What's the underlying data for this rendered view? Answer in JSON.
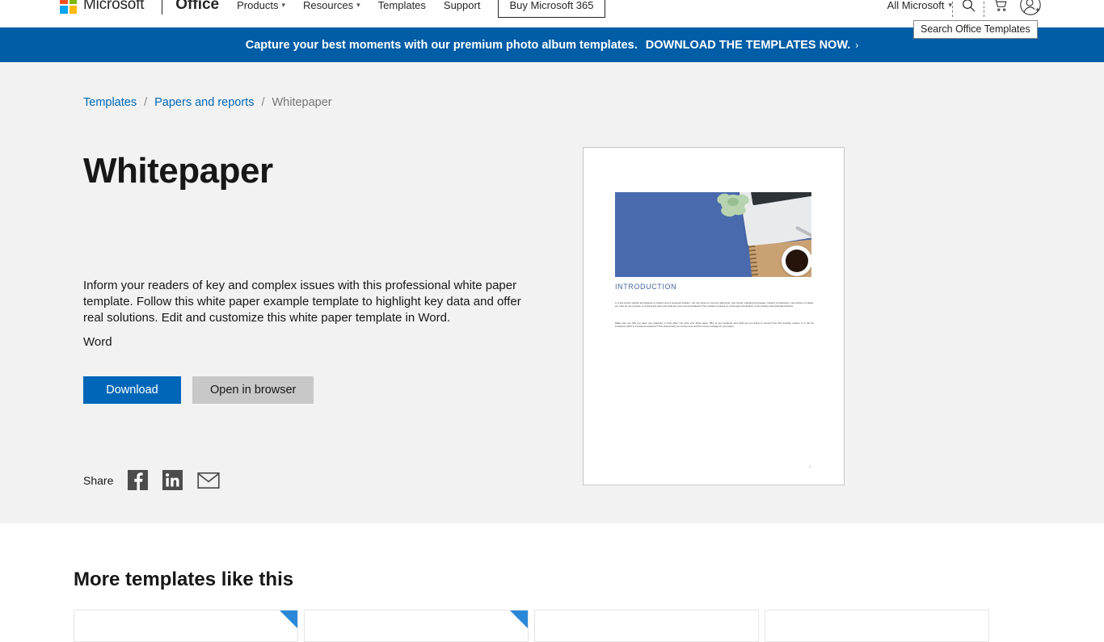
{
  "topnav": {
    "brand": "Microsoft",
    "product": "Office",
    "links": [
      {
        "label": "Products",
        "has_caret": true
      },
      {
        "label": "Resources",
        "has_caret": true
      },
      {
        "label": "Templates",
        "has_caret": false
      },
      {
        "label": "Support",
        "has_caret": false
      }
    ],
    "buy_button": "Buy Microsoft 365",
    "all_microsoft": "All Microsoft",
    "search_tooltip": "Search Office Templates",
    "icons": {
      "search": "search-icon",
      "cart": "cart-icon",
      "account": "account-icon"
    }
  },
  "promo": {
    "text": "Capture your best moments with our premium photo album templates.",
    "cta": "DOWNLOAD THE TEMPLATES NOW.",
    "chevron": "›",
    "background": "#005da6"
  },
  "breadcrumb": {
    "items": [
      {
        "label": "Templates",
        "current": false
      },
      {
        "label": "Papers and reports",
        "current": false
      },
      {
        "label": "Whitepaper",
        "current": true
      }
    ],
    "separator": "/"
  },
  "hero": {
    "title": "Whitepaper",
    "description": "Inform your readers of key and complex issues with this professional white paper template. Follow this white paper example template to highlight key data and offer real solutions. Edit and customize this white paper template in Word.",
    "app": "Word",
    "download_label": "Download",
    "open_in_browser_label": "Open in browser",
    "accent_color": "#0067b8",
    "share": {
      "label": "Share",
      "targets": [
        "facebook-icon",
        "linkedin-icon",
        "email-icon"
      ]
    }
  },
  "preview": {
    "heading": "INTRODUCTION",
    "paragraph_1": "In a few words, identify and address a problem and a proposed solution. You can focus on common dilemmas, new trends, changing techniques, industry comparisons, new entries to market, etc. How do you propose on solving this issue and what are your recommendations? The solution is based on a thorough examination of the problem and potential solutions.",
    "paragraph_2": "Make sure you that you have your audience in mind when you write your white paper. Who is your audience and what are you trying to convey? Are they industry experts or is this an investment pitch to a business audience? This should help you set the tone and the correct verbiage for your paper.",
    "page_number": "1",
    "heading_color": "#44669e",
    "photo_background": "#4a6aae"
  },
  "more_templates": {
    "title": "More templates like this",
    "cards": [
      {
        "ribbon": true
      },
      {
        "ribbon": true
      },
      {
        "ribbon": false
      },
      {
        "ribbon": false
      }
    ]
  }
}
